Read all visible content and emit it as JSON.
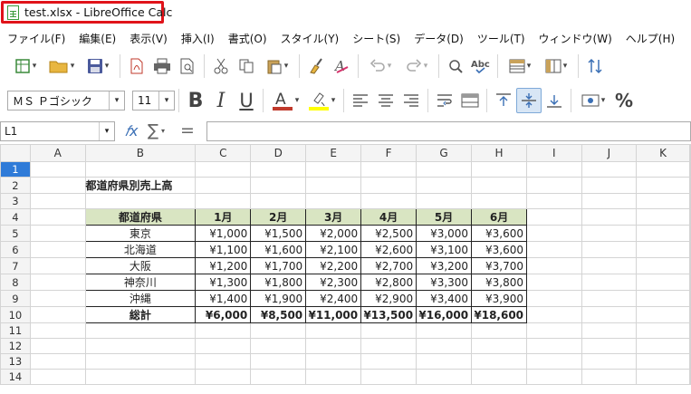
{
  "window": {
    "title": "test.xlsx - LibreOffice Calc"
  },
  "menu": [
    "ファイル(F)",
    "編集(E)",
    "表示(V)",
    "挿入(I)",
    "書式(O)",
    "スタイル(Y)",
    "シート(S)",
    "データ(D)",
    "ツール(T)",
    "ウィンドウ(W)",
    "ヘルプ(H)"
  ],
  "toolbar": {
    "font_name": "ＭＳ Ｐゴシック",
    "font_size": "11",
    "bold": "B",
    "italic": "I",
    "underline": "U",
    "percent": "%"
  },
  "formula_bar": {
    "cell_ref": "L1",
    "formula": ""
  },
  "sheet": {
    "columns": [
      "A",
      "B",
      "C",
      "D",
      "E",
      "F",
      "G",
      "H",
      "I",
      "J",
      "K"
    ],
    "rows": [
      "1",
      "2",
      "3",
      "4",
      "5",
      "6",
      "7",
      "8",
      "9",
      "10",
      "11",
      "12",
      "13",
      "14"
    ],
    "selected_row": "1",
    "title": "都道府県別売上高",
    "table": {
      "header": [
        "都道府県",
        "1月",
        "2月",
        "3月",
        "4月",
        "5月",
        "6月"
      ],
      "rows": [
        [
          "東京",
          "¥1,000",
          "¥1,500",
          "¥2,000",
          "¥2,500",
          "¥3,000",
          "¥3,600"
        ],
        [
          "北海道",
          "¥1,100",
          "¥1,600",
          "¥2,100",
          "¥2,600",
          "¥3,100",
          "¥3,600"
        ],
        [
          "大阪",
          "¥1,200",
          "¥1,700",
          "¥2,200",
          "¥2,700",
          "¥3,200",
          "¥3,700"
        ],
        [
          "神奈川",
          "¥1,300",
          "¥1,800",
          "¥2,300",
          "¥2,800",
          "¥3,300",
          "¥3,800"
        ],
        [
          "沖縄",
          "¥1,400",
          "¥1,900",
          "¥2,400",
          "¥2,900",
          "¥3,400",
          "¥3,900"
        ]
      ],
      "total": [
        "総計",
        "¥6,000",
        "¥8,500",
        "¥11,000",
        "¥13,500",
        "¥16,000",
        "¥18,600"
      ]
    }
  },
  "colors": {
    "title_highlight": "#e0131a",
    "header_fill": "#d9e5c2",
    "selected_row_header": "#2f7bd8",
    "font_color_bar": "#c0392b",
    "highlight_bar": "#ffff00"
  },
  "icons": {
    "toolbar1": [
      "new-sheet-icon",
      "open-folder-icon",
      "save-icon",
      "export-pdf-icon",
      "print-icon",
      "print-preview-icon",
      "cut-icon",
      "copy-icon",
      "paste-icon",
      "clone-formatting-icon",
      "clear-formatting-icon",
      "undo-icon",
      "redo-icon",
      "find-replace-icon",
      "spellcheck-icon",
      "row-icon",
      "column-icon",
      "sort-icon"
    ],
    "toolbar2": [
      "font-color-icon",
      "highlight-color-icon",
      "align-left-icon",
      "align-center-icon",
      "align-right-icon",
      "wrap-text-icon",
      "merge-cells-icon",
      "align-top-icon",
      "align-middle-icon",
      "align-bottom-icon",
      "currency-icon"
    ],
    "formula": [
      "function-wizard-icon",
      "sum-icon",
      "formula-icon"
    ]
  }
}
